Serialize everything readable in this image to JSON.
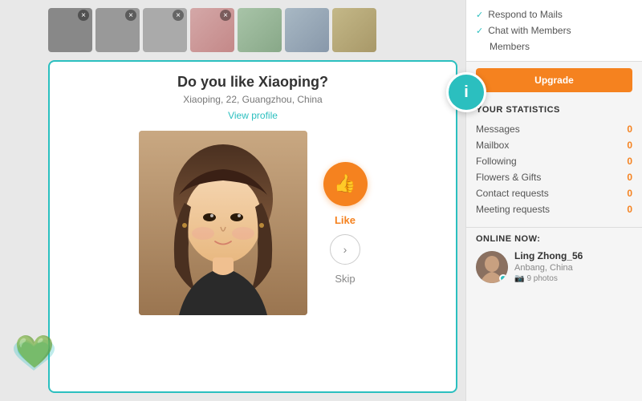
{
  "thumbnails": [
    {
      "id": "t1",
      "colorClass": "t1"
    },
    {
      "id": "t2",
      "colorClass": "t2"
    },
    {
      "id": "t3",
      "colorClass": "t3"
    },
    {
      "id": "t4",
      "colorClass": "t4"
    },
    {
      "id": "t5",
      "colorClass": "t5"
    },
    {
      "id": "t6",
      "colorClass": "t6"
    },
    {
      "id": "t7",
      "colorClass": "t7"
    }
  ],
  "profile": {
    "question": "Do you like Xiaoping?",
    "name": "Xiaoping",
    "age": "22",
    "location": "Guangzhou, China",
    "subtitle": "Xiaoping, 22, Guangzhou, China",
    "view_profile_label": "View profile",
    "like_label": "Like",
    "skip_label": "Skip"
  },
  "sidebar": {
    "menu_items": [
      {
        "label": "Respond to Mails",
        "checked": true
      },
      {
        "label": "Chat with Members",
        "checked": true
      },
      {
        "label": "Members",
        "checked": false
      }
    ],
    "upgrade_label": "Upgrade",
    "stats_title": "YOUR STATISTICS",
    "stats": [
      {
        "label": "Messages",
        "value": "0"
      },
      {
        "label": "Mailbox",
        "value": "0"
      },
      {
        "label": "Following",
        "value": "0"
      },
      {
        "label": "Flowers & Gifts",
        "value": "0"
      },
      {
        "label": "Contact requests",
        "value": "0"
      },
      {
        "label": "Meeting requests",
        "value": "0"
      }
    ],
    "online_title": "ONLINE NOW:",
    "online_user": {
      "name": "Ling Zhong_56",
      "location": "Anbang, China",
      "photos_count": "9 photos"
    }
  },
  "info_icon_label": "i",
  "brand_icon": "❤"
}
